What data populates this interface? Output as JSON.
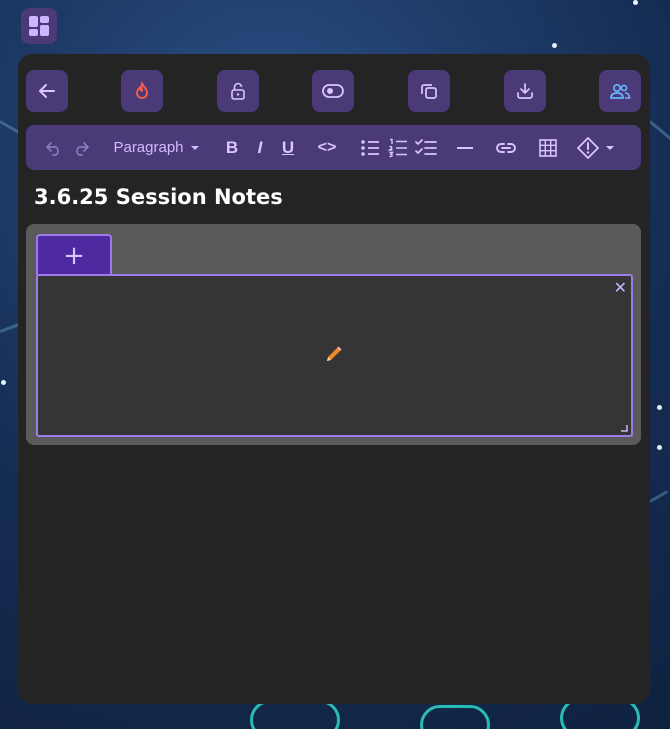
{
  "colors": {
    "accent": "#4b3a78",
    "panel": "#242424",
    "tab_active": "#4e2aa0",
    "border_accent": "#9d7bea",
    "flame": "#ff5c4a",
    "users": "#66b4ff",
    "pencil": "#f08a24"
  },
  "topbar": {
    "icons": [
      "arrow-left-icon",
      "flame-icon",
      "unlock-icon",
      "toggle-icon",
      "copy-icon",
      "download-icon",
      "users-icon"
    ]
  },
  "toolbar": {
    "paragraph_label": "Paragraph",
    "bold_label": "B",
    "italic_label": "I",
    "underline_label": "U",
    "code_label": "<>"
  },
  "document": {
    "title": "3.6.25 Session Notes"
  },
  "tabs": {
    "add_label": "+"
  },
  "editor": {
    "close_label": "✕"
  }
}
